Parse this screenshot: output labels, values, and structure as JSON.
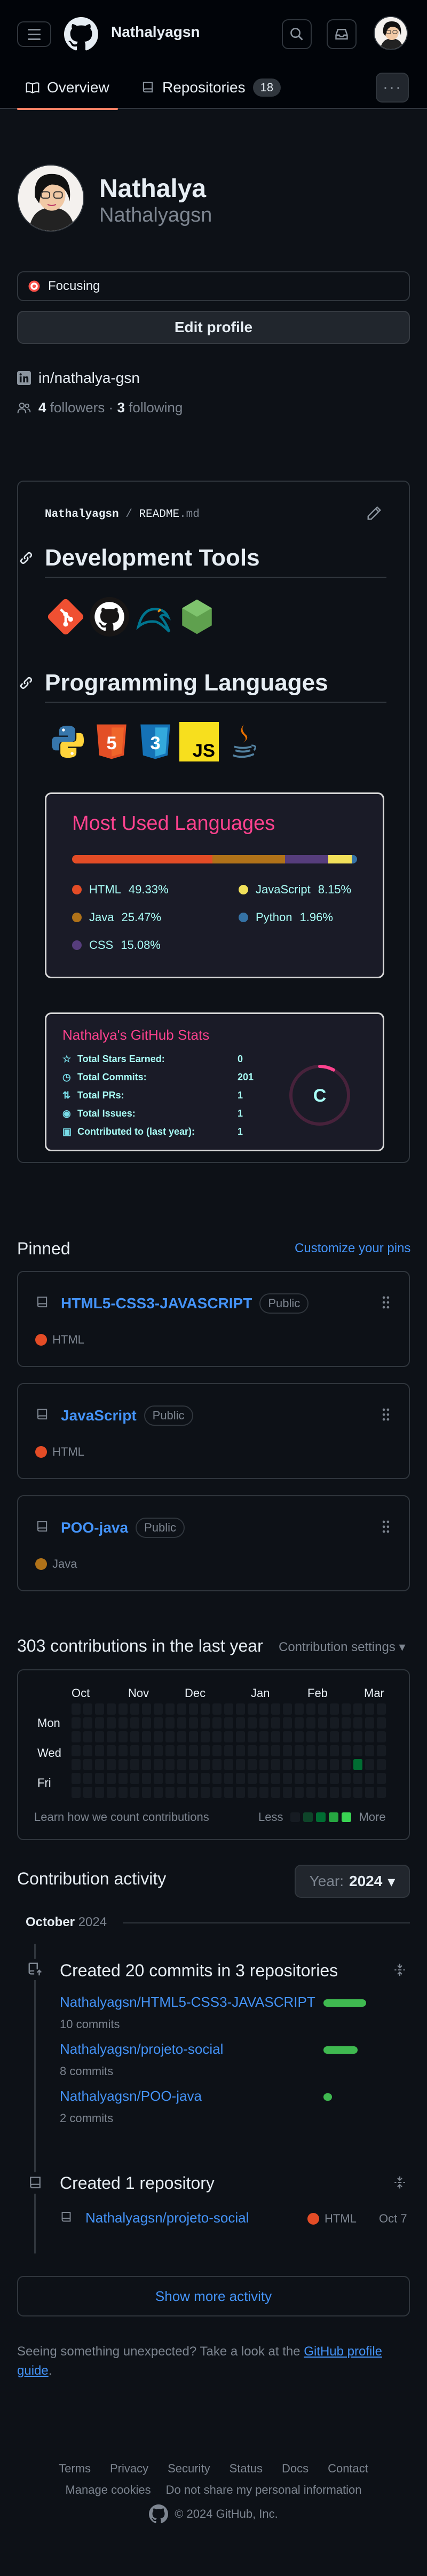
{
  "header": {
    "username": "Nathalyagsn",
    "tabs": [
      {
        "label": "Overview"
      },
      {
        "label": "Repositories",
        "count": "18"
      }
    ],
    "more": "···"
  },
  "profile": {
    "name": "Nathalya",
    "login": "Nathalyagsn",
    "status": "Focusing",
    "edit_label": "Edit profile",
    "linkedin": "in/nathalya-gsn",
    "followers_count": "4",
    "followers_label": "followers",
    "following_count": "3",
    "following_label": "following"
  },
  "readme": {
    "user": "Nathalyagsn",
    "sep": "/",
    "file": "README",
    "ext": ".md",
    "section1": "Development Tools",
    "section2": "Programming Languages",
    "tools": [
      "git-icon",
      "github-icon",
      "mysql-icon",
      "nodejs-icon"
    ],
    "languages_icons": [
      "python-icon",
      "html5-icon",
      "css3-icon",
      "javascript-icon",
      "java-icon"
    ],
    "lang_card": {
      "title": "Most Used Languages",
      "items": [
        {
          "name": "HTML",
          "pct": "49.33%",
          "color": "#e34c26",
          "value": 49.33
        },
        {
          "name": "JavaScript",
          "pct": "8.15%",
          "color": "#f1e05a",
          "value": 8.15
        },
        {
          "name": "Java",
          "pct": "25.47%",
          "color": "#b07219",
          "value": 25.47
        },
        {
          "name": "Python",
          "pct": "1.96%",
          "color": "#3572A5",
          "value": 1.96
        },
        {
          "name": "CSS",
          "pct": "15.08%",
          "color": "#563d7c",
          "value": 15.08
        }
      ]
    },
    "stats_card": {
      "title": "Nathalya's GitHub Stats",
      "rows": [
        {
          "label": "Total Stars Earned:",
          "value": "0"
        },
        {
          "label": "Total Commits:",
          "value": "201"
        },
        {
          "label": "Total PRs:",
          "value": "1"
        },
        {
          "label": "Total Issues:",
          "value": "1"
        },
        {
          "label": "Contributed to (last year):",
          "value": "1"
        }
      ],
      "rank": "C",
      "rank_fraction": 0.08
    }
  },
  "pinned": {
    "title": "Pinned",
    "customize": "Customize your pins",
    "items": [
      {
        "name": "HTML5-CSS3-JAVASCRIPT",
        "visibility": "Public",
        "lang": "HTML",
        "color": "#e34c26"
      },
      {
        "name": "JavaScript",
        "visibility": "Public",
        "lang": "HTML",
        "color": "#e34c26"
      },
      {
        "name": "POO-java",
        "visibility": "Public",
        "lang": "Java",
        "color": "#b07219"
      }
    ]
  },
  "contributions": {
    "title": "303 contributions in the last year",
    "settings": "Contribution settings",
    "months": [
      "Oct",
      "Nov",
      "Dec",
      "Jan",
      "Feb",
      "Mar"
    ],
    "days": [
      "Mon",
      "Wed",
      "Fri"
    ],
    "learn": "Learn how we count contributions",
    "less": "Less",
    "more": "More"
  },
  "activity": {
    "title": "Contribution activity",
    "year_label": "Year:",
    "year": "2024",
    "month": "October",
    "month_year": "2024",
    "commits_title": "Created 20 commits in 3 repositories",
    "commits": [
      {
        "repo": "Nathalyagsn/HTML5-CSS3-JAVASCRIPT",
        "count": "10 commits"
      },
      {
        "repo": "Nathalyagsn/projeto-social",
        "count": "8 commits"
      },
      {
        "repo": "Nathalyagsn/POO-java",
        "count": "2 commits"
      }
    ],
    "repo_title": "Created 1 repository",
    "repo_name": "Nathalyagsn/projeto-social",
    "repo_lang": "HTML",
    "repo_date": "Oct 7",
    "show_more": "Show more activity"
  },
  "notice": {
    "text": "Seeing something unexpected? Take a look at the",
    "link": "GitHub profile guide",
    "end": "."
  },
  "footer": {
    "links1": [
      "Terms",
      "Privacy",
      "Security",
      "Status",
      "Docs",
      "Contact"
    ],
    "links2": [
      "Manage cookies",
      "Do not share my personal information"
    ],
    "copyright": "© 2024 GitHub, Inc."
  },
  "colors": {
    "link": "#4493f8",
    "green": "#3fb950",
    "accent_tab": "#f78166"
  }
}
